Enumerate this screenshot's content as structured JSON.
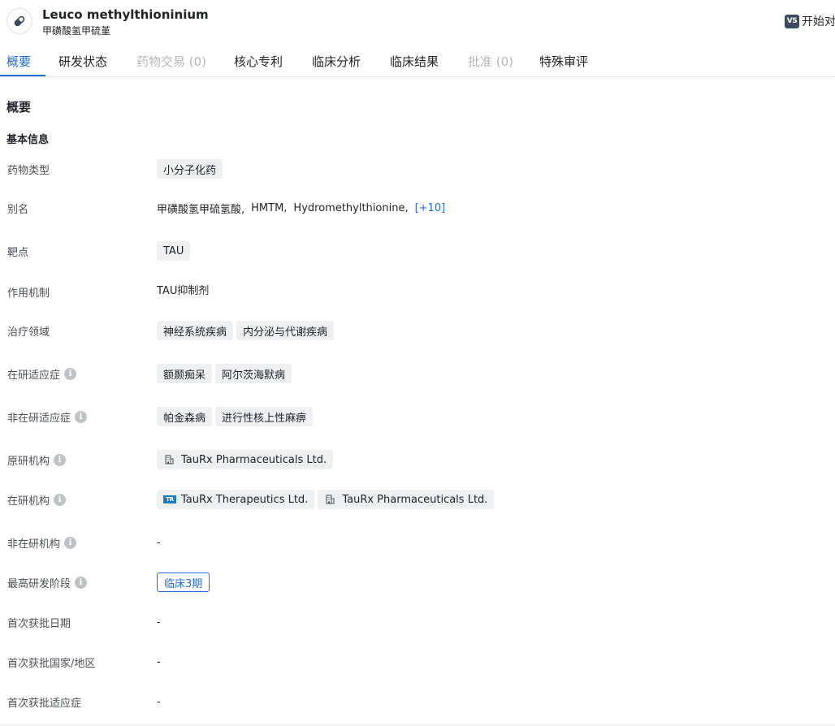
{
  "header": {
    "drug_name": "Leuco methylthioninium",
    "drug_cn_name": "甲磺酸氢甲硫堇",
    "avatar_icon": "pill-icon",
    "compare_icon_text": "VS",
    "compare_label": "开始对"
  },
  "tabs": [
    {
      "label": "概要",
      "state": "active"
    },
    {
      "label": "研发状态",
      "state": "normal"
    },
    {
      "label": "药物交易 (0)",
      "state": "disabled"
    },
    {
      "label": "核心专利",
      "state": "normal"
    },
    {
      "label": "临床分析",
      "state": "normal"
    },
    {
      "label": "临床结果",
      "state": "normal"
    },
    {
      "label": "批准 (0)",
      "state": "disabled"
    },
    {
      "label": "特殊审评",
      "state": "normal"
    }
  ],
  "section": {
    "title": "概要",
    "subtitle": "基本信息"
  },
  "fields": {
    "drug_type": {
      "label": "药物类型",
      "tags": [
        "小分子化药"
      ]
    },
    "alias": {
      "label": "别名",
      "values": [
        "甲磺酸氢甲硫氢酸,",
        "HMTM,",
        "Hydromethylthionine,"
      ],
      "more": "[+10]"
    },
    "target": {
      "label": "靶点",
      "tags": [
        "TAU"
      ]
    },
    "mechanism": {
      "label": "作用机制",
      "value": "TAU抑制剂"
    },
    "therapeutic_area": {
      "label": "治疗领域",
      "tags": [
        "神经系统疾病",
        "内分泌与代谢疾病"
      ]
    },
    "active_indication": {
      "label": "在研适应症",
      "tags": [
        "额颞痴呆",
        "阿尔茨海默病"
      ]
    },
    "inactive_indication": {
      "label": "非在研适应症",
      "tags": [
        "帕金森病",
        "进行性核上性麻痹"
      ]
    },
    "originator": {
      "label": "原研机构",
      "orgs": [
        "TauRx Pharmaceuticals Ltd."
      ]
    },
    "active_org": {
      "label": "在研机构",
      "tr_logo_text": "TR",
      "orgs": [
        "TauRx Therapeutics Ltd.",
        "TauRx Pharmaceuticals Ltd."
      ]
    },
    "inactive_org": {
      "label": "非在研机构",
      "value": "-"
    },
    "highest_phase": {
      "label": "最高研发阶段",
      "value": "临床3期"
    },
    "first_approval_date": {
      "label": "首次获批日期",
      "value": "-"
    },
    "first_approval_country": {
      "label": "首次获批国家/地区",
      "value": "-"
    },
    "first_approval_indication": {
      "label": "首次获批适应症",
      "value": "-"
    }
  },
  "colors": {
    "accent": "#1e6fd9",
    "disabled": "#b3b7bd",
    "tag_bg": "#eef0f2"
  }
}
